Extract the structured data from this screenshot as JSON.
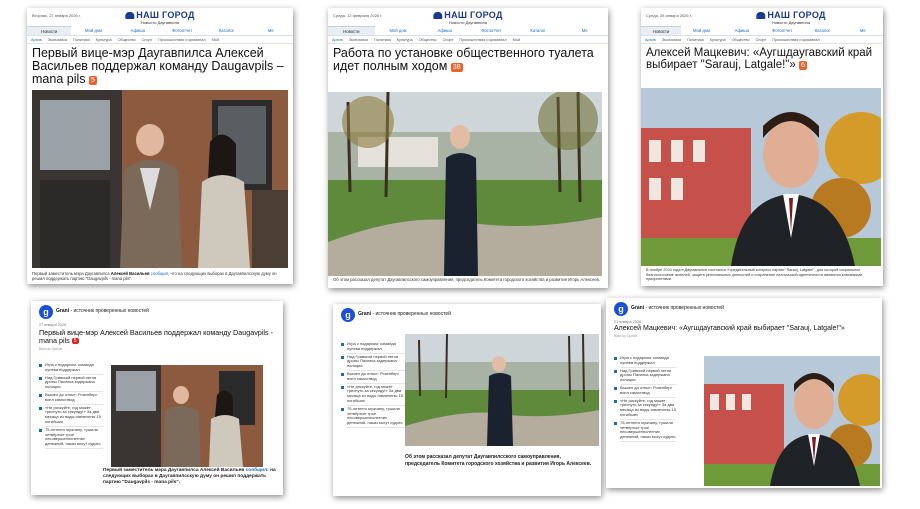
{
  "site": {
    "brand": "НАШ ГОРОД",
    "subtitle": "Новости Даугавпиля",
    "tabs": [
      "Новости",
      "Мой дом",
      "Афиша",
      "Фотоотчет",
      "Каталог",
      "Ме"
    ],
    "categories_home": "Архив",
    "categories": [
      "Экономика",
      "Политика",
      "Культура",
      "Общество",
      "Спорт",
      "Происшествия и криминал",
      "Мой"
    ]
  },
  "panel1": {
    "date": "Вторник, 27 января 2026 г.",
    "title": "Первый вице-мэр Даугавпилса Алексей Васильев поддержал команду Daugavpils – mana pils",
    "badge": "5",
    "caption_pre": "Первый заместитель мэра Даугавпилса",
    "caption_name": "Алексей Васильев",
    "caption_link": "сообщил",
    "caption_post": ", что на следующих выборах в Даугавпилсскую думу он решил поддержать партию \"Daugavpils - mana pils\"."
  },
  "panel2": {
    "date": "Среда, 12 февраля 2026 г.",
    "title": "Работа по установке общественного туалета идет полным ходом",
    "badge": "38",
    "caption": "Об этом рассказал депутат Даугавпилсского самоуправления, председатель Комитета городского хозяйства и развития Игорь Алексеев."
  },
  "panel3": {
    "date": "Среда, 28 января 2026 г.",
    "title": "Алексей Мацкевич: «Аугшдаугавский край выбирает \"Sarauj, Latgale!\"»",
    "badge": "6",
    "caption": "В ноябре 2024 года в Даугавпилсе состоялся Учредительный конгресс партии \"Sarauj, Latgale!\", для которой социальное благосостояние жителей, защита региональных ценностей и сохранение латгальской идентичности являются ключевыми приоритетами."
  },
  "grani": {
    "name": "Grani",
    "tagline": "- источник проверенных новостей",
    "side_items": [
      "Игра с подарком: команда нулева поддержал",
      "Над Гривской первой петли дроны Палатка задержана полиция",
      "Вышел до отпыт: Розенберг вопл самоотвод",
      "«Не рискуйте, год может треснуть за секунду!» За два месяца из воды извлечены 15 погибших",
      "75-летнего мужчину, тушили четвёртые трое несовершеннолетних денежной, наказ могут судить"
    ]
  },
  "panel4": {
    "date": "27 января 2026",
    "title": "Первый вице-мэр Алексей Васильев поддержал команду Daugavpils - mana pils",
    "badge": "5",
    "meta": "Виктор Орлов",
    "caption_pre": "Первый заместитель мэра Даугавпилса Алексей Васильев",
    "caption_link": "сообщил",
    "caption_post": ": на следующих выборах в Даугавпилсскую думу он решил поддержать партию \"Daugavpils - mana pils\"."
  },
  "panel5": {
    "caption": "Об этом рассказал депутат Даугавпилсского самоуправления, председатель Комитета городского хозяйства и развития Игорь Алексеев."
  },
  "panel6": {
    "date": "21 января 2026",
    "title": "Алексей Мацкевич: «Аугшдаугавский край выбирает \"Sarauj, Latgale!\"»",
    "meta": "Виктор Орлов"
  },
  "colors": {
    "brand": "#1c3a8c",
    "accent": "#e8642c",
    "link": "#1c6bb5",
    "grani": "#1d4fd8"
  }
}
